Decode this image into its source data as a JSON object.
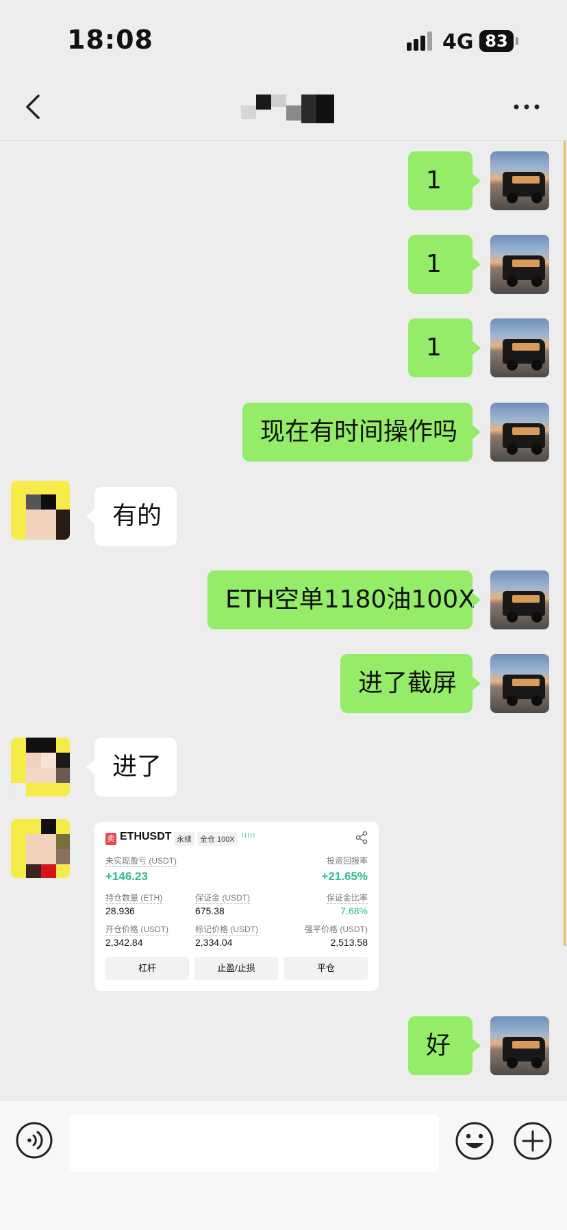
{
  "status_bar": {
    "time": "18:08",
    "network": "4G",
    "battery": "83"
  },
  "nav": {
    "title": ""
  },
  "messages": [
    {
      "side": "right",
      "text": "1"
    },
    {
      "side": "right",
      "text": "1"
    },
    {
      "side": "right",
      "text": "1"
    },
    {
      "side": "right",
      "text": "现在有时间操作吗"
    },
    {
      "side": "left",
      "text": "有的"
    },
    {
      "side": "right",
      "text": "ETH空单1180油100X"
    },
    {
      "side": "right",
      "text": "进了截屏"
    },
    {
      "side": "left",
      "text": "进了"
    },
    {
      "side": "right",
      "text": "好"
    }
  ],
  "trade_card": {
    "badge": "卖",
    "symbol": "ETHUSDT",
    "tag_perpetual": "永续",
    "tag_margin": "全仓 100X",
    "signal_bars": "!!!!!",
    "unrealized_pnl_label": "未实现盈亏 (USDT)",
    "unrealized_pnl": "+146.23",
    "roi_label": "投资回报率",
    "roi": "+21.65%",
    "position_size_label": "持仓数量 (ETH)",
    "position_size": "28.936",
    "margin_label": "保证金 (USDT)",
    "margin": "675.38",
    "margin_ratio_label": "保证金比率",
    "margin_ratio": "7.68%",
    "entry_price_label": "开仓价格 (USDT)",
    "entry_price": "2,342.84",
    "mark_price_label": "标记价格 (USDT)",
    "mark_price": "2,334.04",
    "liq_price_label": "强平价格 (USDT)",
    "liq_price": "2,513.58",
    "buttons": [
      "杠杆",
      "止盈/止损",
      "平仓"
    ]
  },
  "input": {
    "value": "",
    "placeholder": ""
  },
  "colors": {
    "bubble_sent": "#95ec69",
    "bubble_received": "#ffffff",
    "profit_green": "#2ebd85",
    "background": "#ededed"
  }
}
